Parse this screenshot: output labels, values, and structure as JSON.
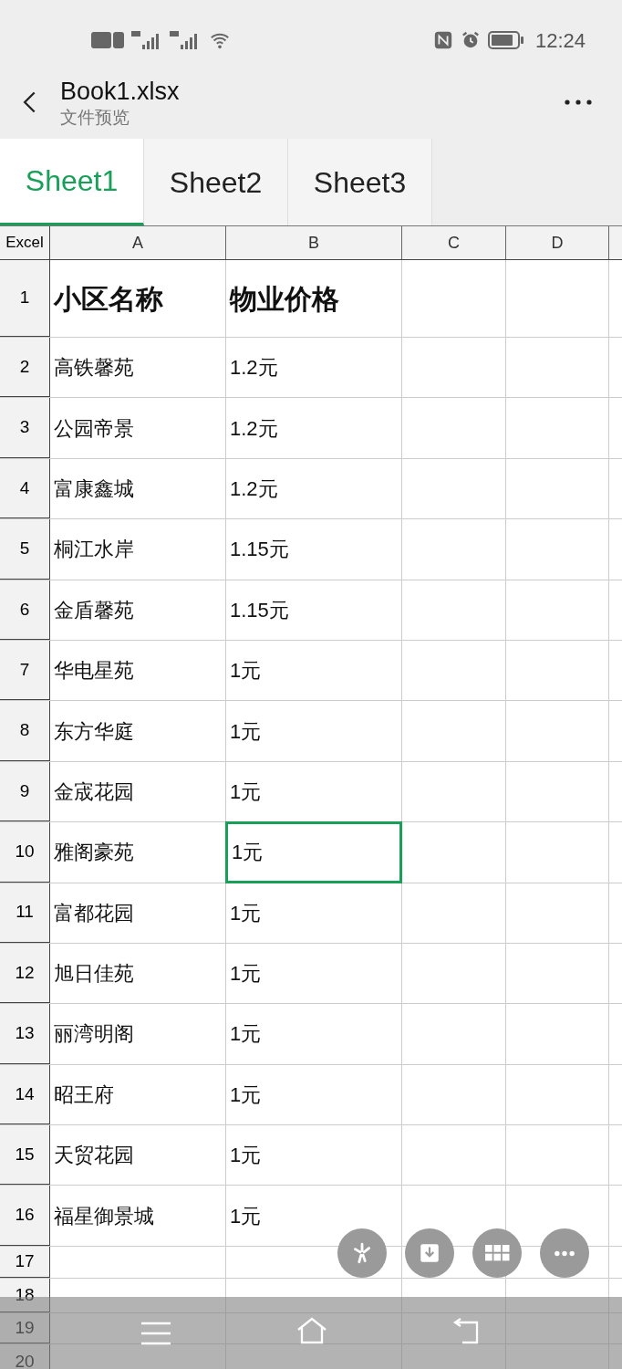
{
  "status_bar": {
    "time": "12:24"
  },
  "header": {
    "title": "Book1.xlsx",
    "subtitle": "文件预览"
  },
  "tabs": [
    {
      "label": "Sheet1",
      "selected": true
    },
    {
      "label": "Sheet2",
      "selected": false
    },
    {
      "label": "Sheet3",
      "selected": false
    }
  ],
  "table": {
    "corner": "Excel",
    "columns": [
      "A",
      "B",
      "C",
      "D"
    ],
    "rows": [
      {
        "number": "1",
        "cells": [
          {
            "text": "小区名称",
            "selected": false
          },
          {
            "text": "物业价格",
            "selected": false
          }
        ]
      },
      {
        "number": "2",
        "cells": [
          {
            "text": "高铁馨苑",
            "selected": false
          },
          {
            "text": "1.2元",
            "selected": false
          }
        ]
      },
      {
        "number": "3",
        "cells": [
          {
            "text": "公园帝景",
            "selected": false
          },
          {
            "text": "1.2元",
            "selected": false
          }
        ]
      },
      {
        "number": "4",
        "cells": [
          {
            "text": "富康鑫城",
            "selected": false
          },
          {
            "text": "1.2元",
            "selected": false
          }
        ]
      },
      {
        "number": "5",
        "cells": [
          {
            "text": "桐江水岸",
            "selected": false
          },
          {
            "text": "1.15元",
            "selected": false
          }
        ]
      },
      {
        "number": "6",
        "cells": [
          {
            "text": "金盾馨苑",
            "selected": false
          },
          {
            "text": "1.15元",
            "selected": false
          }
        ]
      },
      {
        "number": "7",
        "cells": [
          {
            "text": "华电星苑",
            "selected": false
          },
          {
            "text": "1元",
            "selected": false
          }
        ]
      },
      {
        "number": "8",
        "cells": [
          {
            "text": "东方华庭",
            "selected": false
          },
          {
            "text": "1元",
            "selected": false
          }
        ]
      },
      {
        "number": "9",
        "cells": [
          {
            "text": "金宬花园",
            "selected": false
          },
          {
            "text": "1元",
            "selected": false
          }
        ]
      },
      {
        "number": "10",
        "cells": [
          {
            "text": "雅阁豪苑",
            "selected": false
          },
          {
            "text": "1元",
            "selected": true
          }
        ]
      },
      {
        "number": "11",
        "cells": [
          {
            "text": "富都花园",
            "selected": false
          },
          {
            "text": "1元",
            "selected": false
          }
        ]
      },
      {
        "number": "12",
        "cells": [
          {
            "text": "旭日佳苑",
            "selected": false
          },
          {
            "text": "1元",
            "selected": false
          }
        ]
      },
      {
        "number": "13",
        "cells": [
          {
            "text": "丽湾明阁",
            "selected": false
          },
          {
            "text": "1元",
            "selected": false
          }
        ]
      },
      {
        "number": "14",
        "cells": [
          {
            "text": "昭王府",
            "selected": false
          },
          {
            "text": "1元",
            "selected": false
          }
        ]
      },
      {
        "number": "15",
        "cells": [
          {
            "text": "天贸花园",
            "selected": false
          },
          {
            "text": "1元",
            "selected": false
          }
        ]
      },
      {
        "number": "16",
        "cells": [
          {
            "text": "福星御景城",
            "selected": false
          },
          {
            "text": "1元",
            "selected": false
          }
        ]
      },
      {
        "number": "17"
      },
      {
        "number": "18"
      },
      {
        "number": "19"
      },
      {
        "number": "20"
      }
    ]
  }
}
